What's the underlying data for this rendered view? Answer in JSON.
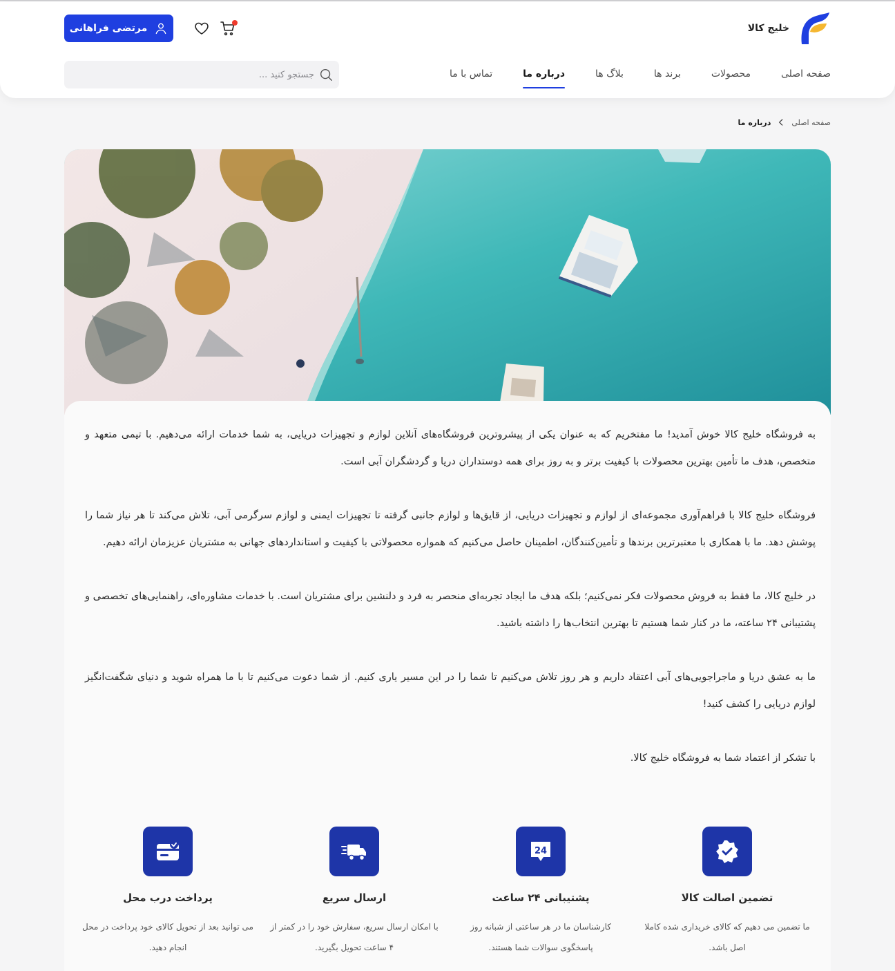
{
  "header": {
    "logo_text": "خلیج کالا",
    "user_button": "مرتضی فراهانی",
    "search_placeholder": "جستجو کنید ...",
    "nav": [
      {
        "label": "صفحه اصلی"
      },
      {
        "label": "محصولات"
      },
      {
        "label": "برند ها"
      },
      {
        "label": "بلاگ ها"
      },
      {
        "label": "درباره ما"
      },
      {
        "label": "تماس با ما"
      }
    ],
    "active_nav": "درباره ما",
    "accent_color": "#1f3fe0"
  },
  "breadcrumb": {
    "home": "صفحه اصلی",
    "current": "درباره ما"
  },
  "about": {
    "paragraphs": [
      "به فروشگاه خلیج کالا خوش آمدید! ما مفتخریم که به عنوان یکی از پیشروترین فروشگاه‌های آنلاین لوازم و تجهیزات دریایی، به شما خدمات ارائه می‌دهیم. با تیمی متعهد و متخصص، هدف ما تأمین بهترین محصولات با کیفیت برتر و به روز برای همه دوستداران دریا و گردشگران آبی است.",
      "فروشگاه خلیج کالا با فراهم‌آوری مجموعه‌ای از لوازم و تجهیزات دریایی، از قایق‌ها و لوازم جانبی گرفته تا تجهیزات ایمنی و لوازم سرگرمی آبی، تلاش می‌کند تا هر نیاز شما را پوشش دهد. ما با همکاری با معتبرترین برندها و تأمین‌کنندگان، اطمینان حاصل می‌کنیم که همواره محصولاتی با کیفیت و استانداردهای جهانی به مشتریان عزیزمان ارائه دهیم.",
      "در خلیج کالا، ما فقط به فروش محصولات فکر نمی‌کنیم؛ بلکه هدف ما ایجاد تجربه‌ای منحصر به فرد و دلنشین برای مشتریان است. با خدمات مشاوره‌ای، راهنمایی‌های تخصصی و پشتیبانی ۲۴ ساعته، ما در کنار شما هستیم تا بهترین انتخاب‌ها را داشته باشید.",
      "ما به عشق دریا و ماجراجویی‌های آبی اعتقاد داریم و هر روز تلاش می‌کنیم تا شما را در این مسیر یاری کنیم. از شما دعوت می‌کنیم تا با ما همراه شوید و دنیای شگفت‌انگیز لوازم دریایی را کشف کنید!",
      "با تشکر از اعتماد شما به فروشگاه خلیج کالا."
    ]
  },
  "features": [
    {
      "icon": "verified-badge-icon",
      "title": "تضمین اصالت کالا",
      "desc": "ما تضمین می دهیم که کالای خریداری شده کاملا اصل باشد."
    },
    {
      "icon": "support-24-icon",
      "title": "پشتیبانی ۲۴ ساعت",
      "desc": "کارشناسان ما در هر ساعتی از شبانه روز پاسخگوی سوالات شما هستند.",
      "badge_text": "24"
    },
    {
      "icon": "fast-delivery-truck-icon",
      "title": "ارسال سریع",
      "desc": "با امکان ارسال سریع، سفارش خود را در کمتر از ۴ ساعت تحویل بگیرید."
    },
    {
      "icon": "card-payment-icon",
      "title": "پرداخت درب محل",
      "desc": "می توانید بعد از تحویل کالای خود پرداخت در محل انجام دهید."
    }
  ],
  "feature_icon_color": "#1e35a8"
}
